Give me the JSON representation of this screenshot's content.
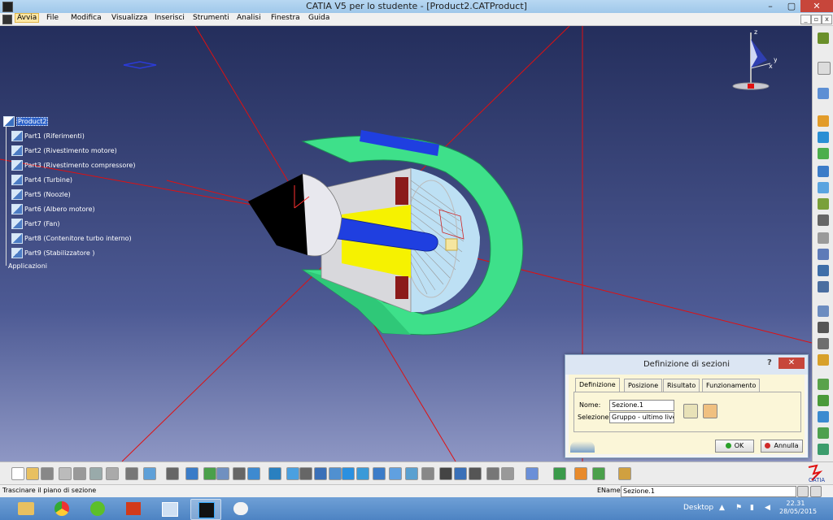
{
  "window": {
    "title": "CATIA V5 per lo studente - [Product2.CATProduct]"
  },
  "menu": {
    "items": [
      "Avvia",
      "File",
      "Modifica",
      "Visualizza",
      "Inserisci",
      "Strumenti",
      "Analisi",
      "Finestra",
      "Guida"
    ],
    "active": "Avvia"
  },
  "tree": {
    "root": "Product2",
    "parts": [
      "Part1 (Riferimenti)",
      "Part2 (Rivestimento motore)",
      "Part3 (Rivestimento compressore)",
      "Part4 (Turbine)",
      "Part5 (Noozle)",
      "Part6 (Albero motore)",
      "Part7 (Fan)",
      "Part8 (Contenitore turbo interno)",
      "Part9 (Stabilizzatore )"
    ],
    "applications": "Applicazioni"
  },
  "compass": {
    "x": "x",
    "y": "y",
    "z": "z"
  },
  "dialog": {
    "title": "Definizione di sezioni",
    "help": "?",
    "close": "✕",
    "tabs": [
      "Definizione",
      "Posizione",
      "Risultato",
      "Funzionamento"
    ],
    "selected_tab": "Definizione",
    "name_label": "Nome:",
    "name_value": "Sezione.1",
    "selection_label": "Selezione:",
    "selection_value": "Gruppo - ultimo live",
    "ok_label": "OK",
    "cancel_label": "Annulla"
  },
  "status": {
    "message": "Trascinare il piano di sezione",
    "ename_label": "EName",
    "ename_value": "Sezione.1"
  },
  "catia_logo": "CATIA",
  "taskbar": {
    "desktop_label": "Desktop",
    "time": "22.31",
    "date": "28/05/2015"
  },
  "colors": {
    "viewport_top": "#242e5c",
    "viewport_bottom": "#8e97c4",
    "engine_outer": "#3ee08a",
    "shaft": "#1f3fe0",
    "cone": "#000000",
    "plane_lines": "#e01010",
    "dialog_body": "#fbf6d8"
  }
}
